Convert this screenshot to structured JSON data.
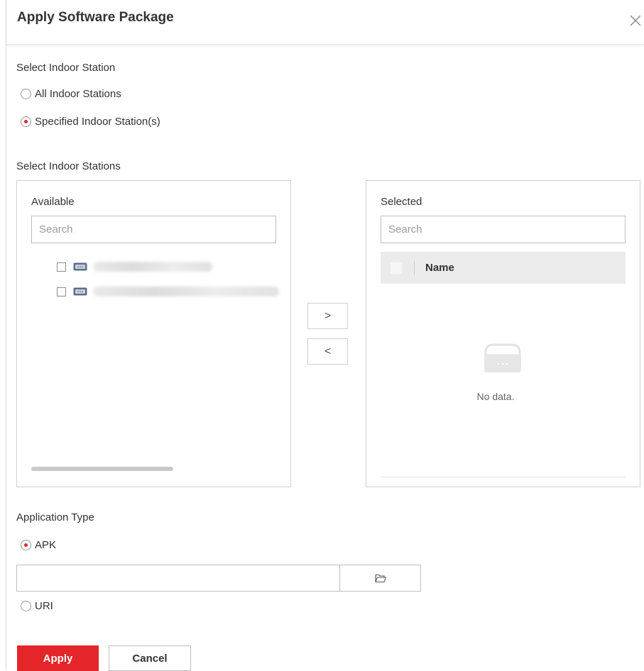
{
  "dialog": {
    "title": "Apply Software Package",
    "close_icon": "close-icon"
  },
  "station_mode": {
    "label": "Select Indoor Station",
    "options": [
      {
        "label": "All Indoor Stations",
        "checked": false
      },
      {
        "label": "Specified Indoor Station(s)",
        "checked": true
      }
    ]
  },
  "stations": {
    "label": "Select Indoor Stations",
    "available": {
      "label": "Available",
      "search_placeholder": "Search",
      "items": [
        {
          "name": "",
          "checked": false,
          "icon": "indoor-station-icon"
        },
        {
          "name": "",
          "checked": false,
          "icon": "indoor-station-icon"
        }
      ]
    },
    "move_right": ">",
    "move_left": "<",
    "selected": {
      "label": "Selected",
      "search_placeholder": "Search",
      "column_name": "Name",
      "empty_text": "No data.",
      "empty_icon": "empty-box-icon"
    }
  },
  "application": {
    "label": "Application Type",
    "options": [
      {
        "label": "APK",
        "checked": true
      },
      {
        "label": "URI",
        "checked": false
      }
    ],
    "file_value": "",
    "browse_icon": "folder-open-icon"
  },
  "footer": {
    "apply_label": "Apply",
    "cancel_label": "Cancel"
  },
  "colors": {
    "accent": "#e4262a",
    "border": "#cfcfcf",
    "header_bg": "#ebebeb"
  }
}
